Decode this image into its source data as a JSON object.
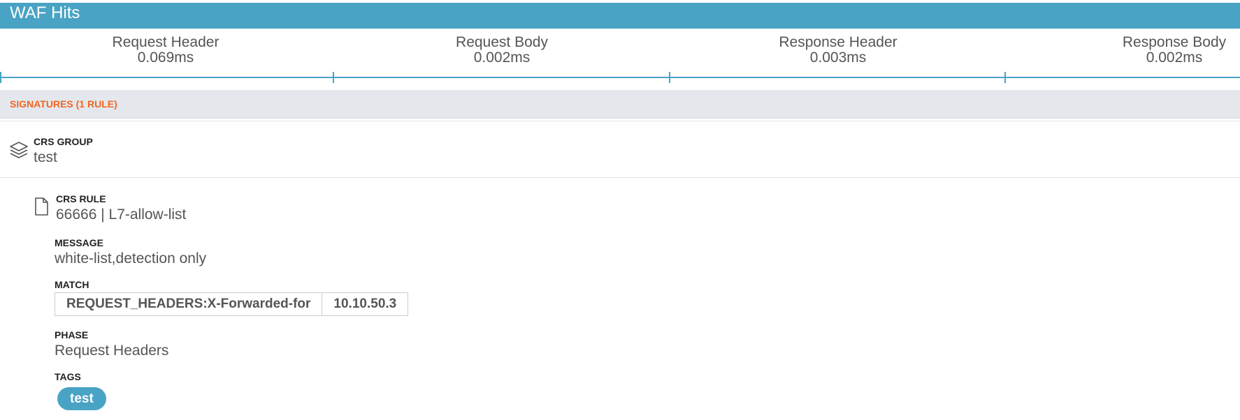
{
  "header": {
    "title": "WAF Hits"
  },
  "timeline": {
    "phases": [
      {
        "label": "Request Header",
        "value": "0.069ms"
      },
      {
        "label": "Request Body",
        "value": "0.002ms"
      },
      {
        "label": "Response Header",
        "value": "0.003ms"
      },
      {
        "label": "Response Body",
        "value": "0.002ms"
      }
    ]
  },
  "signatures": {
    "title": "SIGNATURES (1 RULE)"
  },
  "group": {
    "icon": "layers-icon",
    "label": "CRS GROUP",
    "value": "test"
  },
  "rule": {
    "icon": "document-icon",
    "label": "CRS RULE",
    "value": "66666 | L7-allow-list",
    "message_label": "MESSAGE",
    "message": "white-list,detection only",
    "match_label": "MATCH",
    "match": {
      "variable": "REQUEST_HEADERS:X-Forwarded-for",
      "value": "10.10.50.3"
    },
    "phase_label": "PHASE",
    "phase": "Request Headers",
    "tags_label": "TAGS",
    "tags": [
      "test"
    ]
  },
  "colors": {
    "accent": "#49a3c4",
    "signature_title": "#f26522",
    "band": "#e4e8ec"
  }
}
